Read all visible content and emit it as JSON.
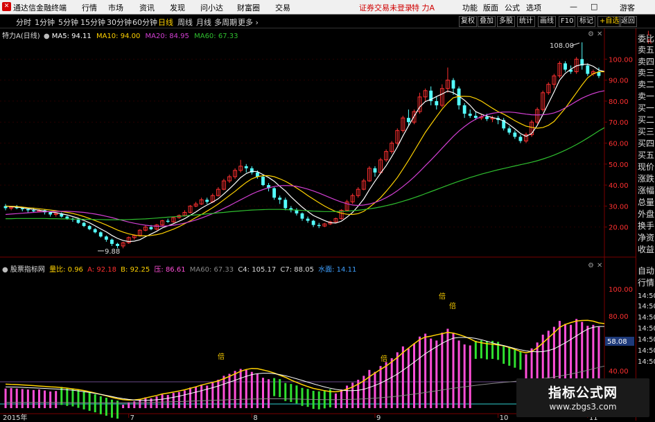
{
  "app": {
    "title": "通达信金融终端"
  },
  "menu": [
    "行情",
    "市场",
    "资讯",
    "发现",
    "问小达",
    "财富圈",
    "交易"
  ],
  "notice": "证券交易未登录",
  "stock_name": "特 力A",
  "menu_right": [
    "功能",
    "版面",
    "公式",
    "选项",
    "游客"
  ],
  "periods": [
    "分时",
    "1分钟",
    "5分钟",
    "15分钟",
    "30分钟",
    "60分钟",
    "日线",
    "周线",
    "月线",
    "多周期",
    "更多"
  ],
  "active_period": "日线",
  "toolbar_right": [
    "复权",
    "叠加",
    "多股",
    "统计",
    "画线",
    "F10",
    "标记",
    "+自选",
    "返回"
  ],
  "main_legend": {
    "title": "特力A(日线)",
    "ma5": "MA5: 94.11",
    "ma10": "MA10: 94.00",
    "ma20": "MA20: 84.95",
    "ma60": "MA60: 67.33"
  },
  "sub_legend": {
    "title": "股票指标网",
    "liangbi": "量比: 0.96",
    "a": "A: 92.18",
    "b": "B: 92.25",
    "ya": "压: 86.61",
    "ma60": "MA60: 67.33",
    "c4": "C4: 105.17",
    "c7": "C7: 88.05",
    "shuimian": "水面: 14.11"
  },
  "annotations": {
    "high": "108.00",
    "low": "9.88",
    "bei": "倍"
  },
  "sub_value_box": "58.08",
  "date_axis": [
    "2015年",
    "7",
    "8",
    "9",
    "10",
    "11"
  ],
  "right_panel": [
    "L",
    "R",
    "委比",
    "卖五",
    "卖四",
    "卖三",
    "卖二",
    "卖一",
    "买一",
    "买二",
    "买三",
    "买四",
    "买五",
    "现价",
    "涨跌",
    "涨幅",
    "总量",
    "外盘",
    "换手",
    "净资",
    "收益",
    "自动",
    "行情",
    "14:50",
    "14:50",
    "14:50",
    "14:50",
    "14:50",
    "14:50",
    "14:50"
  ],
  "watermark": {
    "line1": "指标公式网",
    "line2": "www.zbgs3.com"
  },
  "chart_data": {
    "type": "candlestick",
    "main_ylim": [
      9,
      112
    ],
    "main_yticks": [
      "100.00",
      "90.00",
      "80.00",
      "70.00",
      "60.00",
      "50.00",
      "40.00",
      "30.00",
      "20.00"
    ],
    "sub_yticks": [
      "100.00",
      "80.00",
      "40.00"
    ],
    "candles": [
      [
        30,
        29,
        31,
        28
      ],
      [
        29,
        29.5,
        30,
        28
      ],
      [
        29.5,
        29,
        30.5,
        28.5
      ],
      [
        29,
        28.5,
        29.5,
        27.5
      ],
      [
        28.5,
        28,
        29,
        27
      ],
      [
        28,
        27.5,
        29,
        27
      ],
      [
        27.5,
        28,
        28.5,
        27
      ],
      [
        28,
        27,
        28.5,
        26
      ],
      [
        27,
        26,
        27.5,
        25
      ],
      [
        26,
        26.5,
        27,
        25
      ],
      [
        26.5,
        25,
        27,
        24.5
      ],
      [
        25,
        24,
        25.5,
        23.5
      ],
      [
        24,
        23.5,
        24.5,
        22.5
      ],
      [
        23.5,
        22,
        24,
        21.5
      ],
      [
        22,
        20.5,
        22.5,
        20
      ],
      [
        20.5,
        19,
        21,
        18.5
      ],
      [
        19,
        17.5,
        19.5,
        17
      ],
      [
        17.5,
        15.5,
        18,
        15
      ],
      [
        15.5,
        14,
        16,
        13
      ],
      [
        14,
        12,
        14.5,
        11
      ],
      [
        12,
        11,
        12.5,
        10
      ],
      [
        11,
        12.5,
        13,
        9.88
      ],
      [
        12.5,
        15,
        15.5,
        12
      ],
      [
        15,
        16,
        16.5,
        14
      ],
      [
        16,
        18.5,
        19,
        15.5
      ],
      [
        18.5,
        20,
        21,
        18
      ],
      [
        20,
        19,
        21,
        18.5
      ],
      [
        19,
        21,
        21.5,
        18.5
      ],
      [
        21,
        23,
        23.5,
        20.5
      ],
      [
        23,
        22.5,
        24,
        22
      ],
      [
        22.5,
        24.5,
        25,
        22
      ],
      [
        24.5,
        25.5,
        26,
        24
      ],
      [
        25.5,
        27,
        28,
        25
      ],
      [
        27,
        30,
        30.5,
        26.5
      ],
      [
        30,
        31,
        32,
        29.5
      ],
      [
        31,
        33,
        34,
        30.5
      ],
      [
        33,
        32,
        34,
        31
      ],
      [
        32,
        35,
        36,
        31.5
      ],
      [
        35,
        38,
        39,
        34.5
      ],
      [
        38,
        42,
        43,
        37.5
      ],
      [
        42,
        44,
        45,
        41
      ],
      [
        44,
        47,
        48,
        43
      ],
      [
        47,
        49,
        52,
        46
      ],
      [
        49,
        48,
        50,
        46
      ],
      [
        48,
        46,
        49,
        45
      ],
      [
        46,
        44,
        47,
        43
      ],
      [
        44,
        40,
        45,
        39.5
      ],
      [
        40,
        38.5,
        41,
        37
      ],
      [
        38.5,
        34,
        39,
        33
      ],
      [
        34,
        33,
        35,
        31
      ],
      [
        33,
        29,
        34,
        28
      ],
      [
        29,
        28,
        30,
        27
      ],
      [
        28,
        26.5,
        29,
        25.5
      ],
      [
        26.5,
        24,
        27,
        23
      ],
      [
        24,
        23,
        25,
        22
      ],
      [
        23,
        21,
        23.5,
        20
      ],
      [
        21,
        20.5,
        22,
        19.5
      ],
      [
        20.5,
        21.5,
        22,
        20
      ],
      [
        21.5,
        22.5,
        23,
        21
      ],
      [
        22.5,
        24,
        24.5,
        22
      ],
      [
        24,
        28,
        28.5,
        23.5
      ],
      [
        28,
        32,
        33,
        27.5
      ],
      [
        32,
        35,
        36,
        31
      ],
      [
        35,
        38,
        39,
        34
      ],
      [
        38,
        42,
        43,
        37.5
      ],
      [
        42,
        48,
        49,
        41.5
      ],
      [
        48,
        46,
        49,
        44
      ],
      [
        46,
        52,
        53,
        45.5
      ],
      [
        52,
        56,
        57,
        51
      ],
      [
        56,
        60,
        61,
        55
      ],
      [
        60,
        66,
        67,
        59
      ],
      [
        66,
        72,
        73,
        65
      ],
      [
        72,
        70,
        76,
        68
      ],
      [
        70,
        75,
        76,
        69
      ],
      [
        75,
        82,
        84,
        74
      ],
      [
        82,
        85,
        86,
        80
      ],
      [
        85,
        80,
        87,
        78
      ],
      [
        80,
        78,
        82,
        76
      ],
      [
        78,
        86,
        88,
        77
      ],
      [
        86,
        90,
        96,
        84
      ],
      [
        90,
        86,
        91,
        83
      ],
      [
        86,
        78,
        87,
        76
      ],
      [
        78,
        74,
        79,
        72
      ],
      [
        74,
        73,
        76,
        72
      ],
      [
        73,
        72,
        75,
        71
      ],
      [
        72,
        72.5,
        74,
        71
      ],
      [
        72.5,
        71.5,
        74,
        70.5
      ],
      [
        71.5,
        72,
        73,
        70
      ],
      [
        72,
        71,
        73,
        69
      ],
      [
        71,
        67,
        72,
        66
      ],
      [
        67,
        65,
        68,
        64
      ],
      [
        65,
        63,
        66,
        62
      ],
      [
        63,
        61,
        64,
        60
      ],
      [
        61,
        64,
        65,
        60
      ],
      [
        64,
        70,
        71,
        63
      ],
      [
        70,
        76,
        77,
        69
      ],
      [
        76,
        84,
        85,
        75
      ],
      [
        84,
        88,
        89,
        83
      ],
      [
        88,
        92,
        93,
        86
      ],
      [
        92,
        98,
        99,
        91
      ],
      [
        98,
        95,
        99,
        94
      ],
      [
        95,
        94,
        97,
        93
      ],
      [
        94,
        100,
        101,
        93
      ],
      [
        100,
        97,
        108,
        95
      ],
      [
        97,
        93,
        98,
        92
      ],
      [
        93,
        94,
        95,
        92
      ],
      [
        94,
        92,
        96,
        91
      ]
    ],
    "ma_series": [
      {
        "name": "MA5",
        "color": "#ffffff",
        "values": [
          30,
          29.7,
          29.5,
          29.2,
          28.8,
          28.4,
          28,
          27.6,
          27.2,
          26.9,
          26.3,
          25.8,
          25,
          24.2,
          23.2,
          22,
          20.6,
          19.1,
          17.7,
          16,
          14.6,
          13.6,
          13.1,
          13.3,
          14,
          15.4,
          16.7,
          18,
          19.6,
          20.6,
          21.6,
          22.8,
          24,
          25.6,
          27.2,
          29,
          30.5,
          31.9,
          33.5,
          35.8,
          38.2,
          40.8,
          43.6,
          45.5,
          46.6,
          46.4,
          45,
          43.6,
          41.8,
          39.4,
          37.2,
          34.4,
          31.9,
          29.5,
          27.4,
          25.5,
          24.3,
          23.1,
          22.1,
          21.9,
          22.8,
          24.7,
          27,
          30,
          33.4,
          37.8,
          41.8,
          45.6,
          49.2,
          53.6,
          58.2,
          63.4,
          68.2,
          72.8,
          77.2,
          79.8,
          80.8,
          82.2,
          83.4,
          84.8,
          84,
          82.4,
          80.4,
          78,
          75,
          73.8,
          72.8,
          72.2,
          71.5,
          70.6,
          68.8,
          66.8,
          64.6,
          63.2,
          64.6,
          68.4,
          73.6,
          79,
          84.4,
          90,
          93.2,
          95.2,
          96.8,
          97.4,
          97.6,
          96.6,
          94.8,
          94.1
        ]
      },
      {
        "name": "MA10",
        "color": "#ffd200",
        "values": [
          30,
          29.9,
          29.8,
          29.5,
          29.2,
          29,
          28.7,
          28.4,
          28.1,
          27.8,
          27.4,
          27,
          26.5,
          25.8,
          25,
          24.1,
          23.1,
          22.1,
          21,
          19.8,
          18.6,
          17.6,
          16.8,
          16.2,
          15.8,
          15.8,
          16,
          16.4,
          17,
          18,
          19,
          20.2,
          21.6,
          23,
          24.5,
          26,
          27.6,
          29.2,
          31,
          33,
          35,
          37,
          39.2,
          41.3,
          43,
          44,
          44.5,
          44.5,
          44,
          43,
          41.8,
          40.3,
          38.6,
          36.9,
          35,
          33.3,
          31.6,
          30,
          28.6,
          27.4,
          26.6,
          26.1,
          26,
          26.4,
          27.5,
          29.4,
          31.6,
          34,
          37,
          40.2,
          43.6,
          47.6,
          51.8,
          56.2,
          60.7,
          65.1,
          68.9,
          72.6,
          76.2,
          79.2,
          81.6,
          82.3,
          82.3,
          82.2,
          81.3,
          80,
          78.3,
          76.6,
          75,
          73.8,
          72.3,
          70.7,
          69.3,
          68.1,
          67.5,
          67.1,
          67.4,
          68.5,
          70.3,
          73.4,
          76.6,
          80.3,
          84,
          87.7,
          91.1,
          93.1,
          94,
          94
        ]
      },
      {
        "name": "MA20",
        "color": "#d33fd3",
        "values": [
          26,
          26.2,
          26.4,
          26.6,
          26.8,
          27,
          27.2,
          27.3,
          27.4,
          27.5,
          27.5,
          27.5,
          27.4,
          27.2,
          27,
          26.6,
          26.2,
          25.7,
          25.1,
          24.5,
          23.8,
          23.1,
          22.4,
          21.8,
          21.3,
          20.9,
          20.6,
          20.4,
          20.4,
          20.6,
          20.9,
          21.3,
          21.9,
          22.6,
          23.4,
          24.3,
          25.3,
          26.4,
          27.6,
          28.9,
          30.2,
          31.6,
          33,
          34.4,
          35.7,
          36.9,
          37.9,
          38.7,
          39.3,
          39.7,
          39.8,
          39.7,
          39.4,
          38.8,
          38.1,
          37.2,
          36.2,
          35.1,
          34,
          32.9,
          31.9,
          31.1,
          30.5,
          30.3,
          30.5,
          31,
          31.7,
          32.7,
          34,
          35.5,
          37.3,
          39.3,
          41.5,
          43.9,
          46.5,
          49.2,
          51.9,
          54.7,
          57.6,
          60.4,
          63.2,
          65.7,
          67.9,
          69.8,
          71.4,
          72.6,
          73.5,
          74.2,
          74.6,
          74.8,
          74.8,
          74.6,
          74.2,
          73.8,
          73.5,
          73.4,
          73.5,
          73.8,
          74.4,
          75.4,
          76.8,
          78.3,
          79.9,
          81.4,
          82.6,
          83.6,
          84.4,
          84.95
        ]
      },
      {
        "name": "MA60",
        "color": "#2fbf2f",
        "values": [
          24,
          24,
          24.1,
          24.1,
          24.1,
          24.1,
          24.1,
          24.1,
          24,
          24,
          23.9,
          23.9,
          23.8,
          23.8,
          23.7,
          23.7,
          23.6,
          23.6,
          23.5,
          23.5,
          23.5,
          23.5,
          23.6,
          23.7,
          23.8,
          23.9,
          24.1,
          24.3,
          24.5,
          24.7,
          24.9,
          25.1,
          25.3,
          25.6,
          25.8,
          26,
          26.3,
          26.5,
          26.8,
          27,
          27.3,
          27.5,
          27.7,
          27.9,
          28.1,
          28.2,
          28.3,
          28.4,
          28.4,
          28.4,
          28.3,
          28.2,
          28.1,
          27.9,
          27.8,
          27.6,
          27.5,
          27.4,
          27.4,
          27.4,
          27.5,
          27.6,
          27.8,
          28,
          28.3,
          28.7,
          29.1,
          29.6,
          30.2,
          30.8,
          31.5,
          32.3,
          33.1,
          34,
          34.9,
          35.9,
          36.9,
          37.9,
          38.9,
          39.9,
          40.9,
          41.8,
          42.7,
          43.6,
          44.4,
          45.2,
          45.9,
          46.6,
          47.3,
          47.9,
          48.5,
          49.1,
          49.7,
          50.3,
          50.9,
          51.6,
          52.4,
          53.3,
          54.3,
          55.4,
          56.6,
          57.9,
          59.3,
          60.8,
          62.4,
          64.1,
          65.8,
          67.33
        ]
      }
    ]
  }
}
